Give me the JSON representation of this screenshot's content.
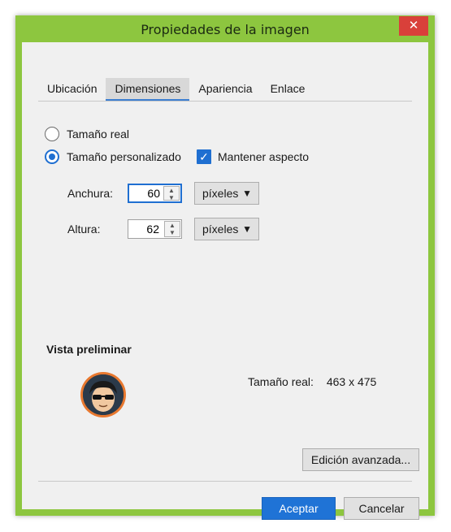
{
  "window": {
    "title": "Propiedades de la imagen",
    "close_glyph": "✕"
  },
  "tabs": [
    {
      "label": "Ubicación"
    },
    {
      "label": "Dimensiones",
      "active": true
    },
    {
      "label": "Apariencia"
    },
    {
      "label": "Enlace"
    }
  ],
  "size_options": {
    "real": {
      "label": "Tamaño real",
      "checked": false
    },
    "custom": {
      "label": "Tamaño personalizado",
      "checked": true
    }
  },
  "keep_aspect": {
    "label": "Mantener aspecto",
    "checked": true,
    "check_glyph": "✓"
  },
  "width": {
    "label": "Anchura:",
    "value": "60",
    "unit": "píxeles"
  },
  "height": {
    "label": "Altura:",
    "value": "62",
    "unit": "píxeles"
  },
  "preview": {
    "label": "Vista preliminar",
    "real_size_label": "Tamaño real:",
    "real_size_value": "463 x 475"
  },
  "buttons": {
    "advanced": "Edición avanzada...",
    "ok": "Aceptar",
    "cancel": "Cancelar"
  },
  "colors": {
    "frame": "#8dc63f",
    "accent": "#1f6fd1",
    "close": "#d9403a"
  }
}
